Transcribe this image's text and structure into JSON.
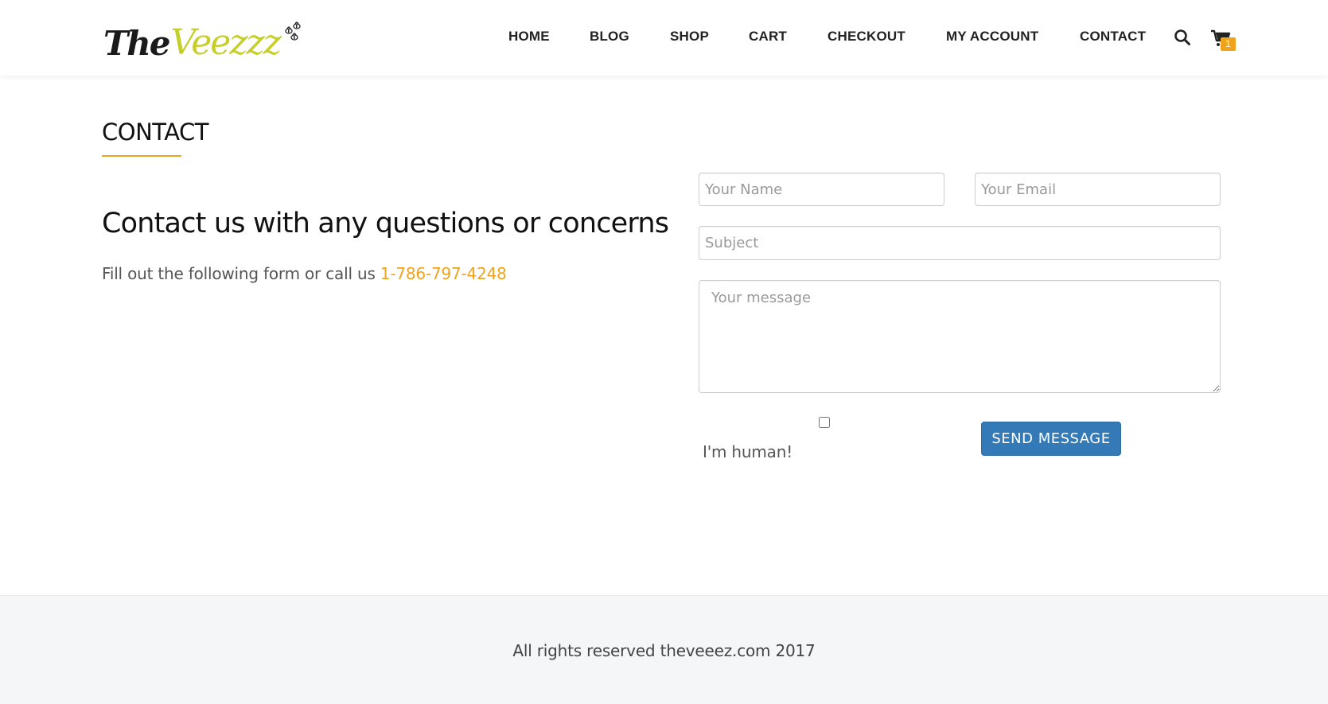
{
  "header": {
    "logo": {
      "text_the": "The",
      "text_brand": "Veezzz",
      "brand_color": "#c6cf2a",
      "icon": "bees-icon"
    },
    "nav": [
      {
        "label": "HOME"
      },
      {
        "label": "BLOG"
      },
      {
        "label": "SHOP"
      },
      {
        "label": "CART"
      },
      {
        "label": "CHECKOUT"
      },
      {
        "label": "MY ACCOUNT"
      },
      {
        "label": "CONTACT"
      }
    ],
    "search_icon": "search-icon",
    "cart": {
      "icon": "cart-icon",
      "count": "1",
      "badge_color": "#f0a31c"
    }
  },
  "main": {
    "page_title": "CONTACT",
    "headline": "Contact us with any questions or concerns",
    "intro_text": "Fill out the following form or call us ",
    "phone": "1-786-797-4248",
    "accent_color": "#f0a31c"
  },
  "form": {
    "name_placeholder": "Your Name",
    "email_placeholder": "Your Email",
    "subject_placeholder": "Subject",
    "message_placeholder": "Your message",
    "human_label": "I'm human!",
    "submit_label": "SEND MESSAGE",
    "submit_color": "#337ab7"
  },
  "footer": {
    "copyright": "All rights reserved theveeez.com 2017"
  }
}
